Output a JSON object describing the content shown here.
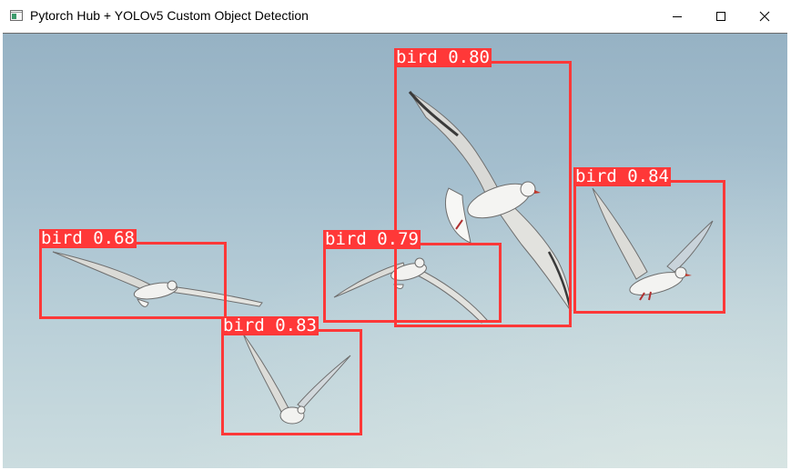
{
  "window": {
    "title": "Pytorch Hub + YOLOv5 Custom Object Detection",
    "icon": "app-window-icon",
    "controls": [
      "minimize-icon",
      "maximize-icon",
      "close-icon"
    ]
  },
  "detection": {
    "box_color": "#ff3838",
    "label_text_color": "#ffffff",
    "items": [
      {
        "label": "bird 0.80"
      },
      {
        "label": "bird 0.84"
      },
      {
        "label": "bird 0.68"
      },
      {
        "label": "bird 0.79"
      },
      {
        "label": "bird 0.83"
      }
    ]
  }
}
